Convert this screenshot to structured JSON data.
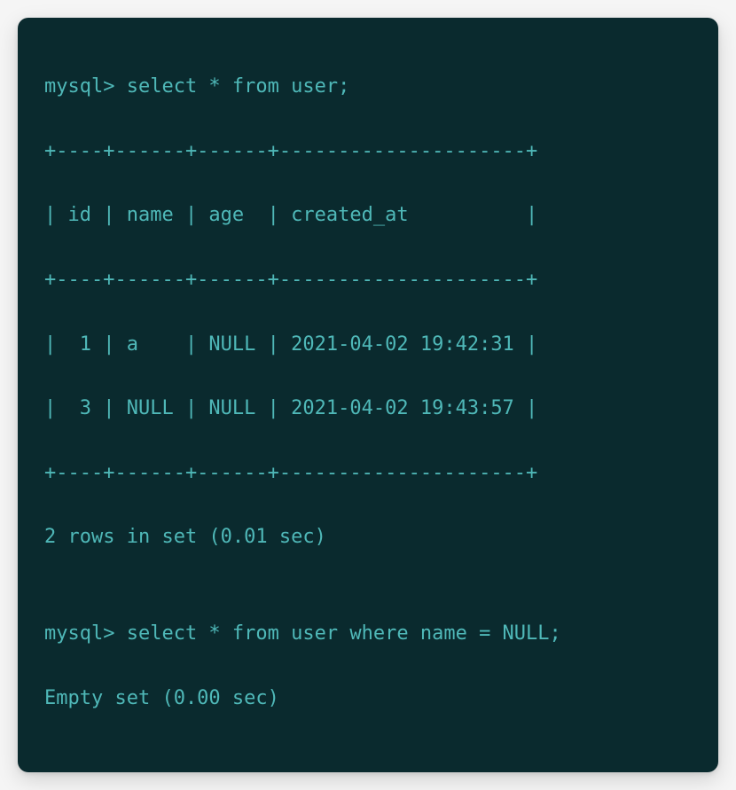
{
  "terminal": {
    "lines": [
      "mysql> select * from user;",
      "+----+------+------+---------------------+",
      "| id | name | age  | created_at          |",
      "+----+------+------+---------------------+",
      "|  1 | a    | NULL | 2021-04-02 19:42:31 |",
      "|  3 | NULL | NULL | 2021-04-02 19:43:57 |",
      "+----+------+------+---------------------+",
      "2 rows in set (0.01 sec)",
      "",
      "mysql> select * from user where name = NULL;",
      "Empty set (0.00 sec)"
    ]
  },
  "query1": {
    "prompt": "mysql>",
    "sql": "select * from user;",
    "columns": [
      "id",
      "name",
      "age",
      "created_at"
    ],
    "rows": [
      {
        "id": 1,
        "name": "a",
        "age": null,
        "created_at": "2021-04-02 19:42:31"
      },
      {
        "id": 3,
        "name": null,
        "age": null,
        "created_at": "2021-04-02 19:43:57"
      }
    ],
    "result_status": "2 rows in set (0.01 sec)"
  },
  "query2": {
    "prompt": "mysql>",
    "sql": "select * from user where name = NULL;",
    "result_status": "Empty set (0.00 sec)"
  }
}
